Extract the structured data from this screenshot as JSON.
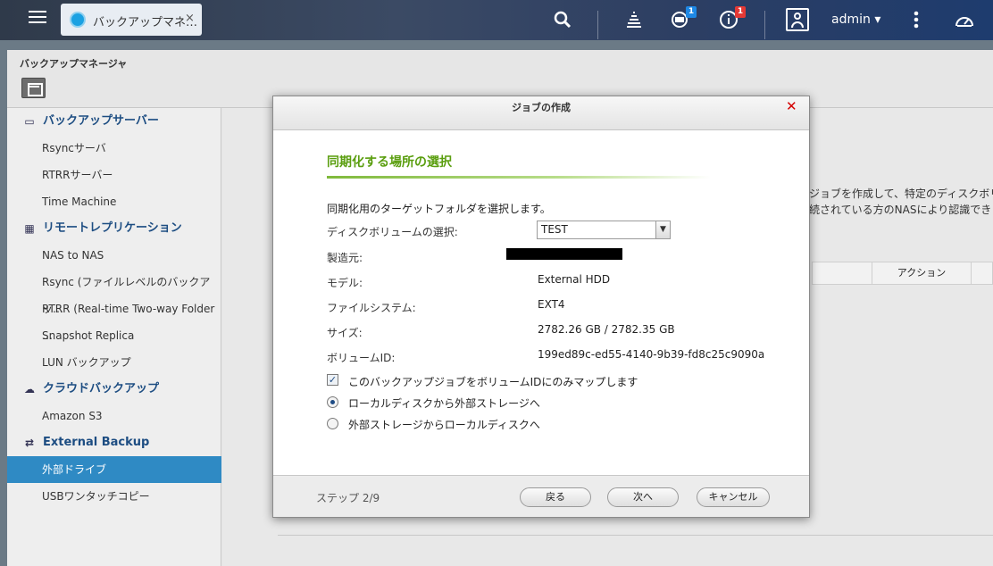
{
  "topbar": {
    "app_tab_title": "バックアップマネ…",
    "app_tab_close": "×",
    "user_name": "admin ▾",
    "badge_backup_count": "1",
    "badge_notice_count": "1"
  },
  "window": {
    "title": "バックアップマネージャ"
  },
  "sidebar": {
    "groups": [
      {
        "label": "バックアップサーバー",
        "items": [
          "Rsyncサーバ",
          "RTRRサーバー",
          "Time Machine"
        ]
      },
      {
        "label": "リモートレプリケーション",
        "items": [
          "NAS to NAS",
          "Rsync (ファイルレベルのバックアッ…",
          "RTRR (Real-time Two-way Folder …",
          "Snapshot Replica",
          "LUN バックアップ"
        ]
      },
      {
        "label": "クラウドバックアップ",
        "items": [
          "Amazon S3"
        ]
      },
      {
        "label": "External Backup",
        "items": [
          "外部ドライブ",
          "USBワンタッチコピー"
        ]
      }
    ],
    "active_item": "外部ドライブ"
  },
  "content": {
    "text_line1": "ジョブを作成して、特定のディスクボリュー",
    "text_line2": "続されている方のNASにより認識できます",
    "table_action_header": "アクション"
  },
  "dialog": {
    "title": "ジョブの作成",
    "close": "✕",
    "heading": "同期化する場所の選択",
    "intro": "同期化用のターゲットフォルダを選択します。",
    "disk_volume_label": "ディスクボリュームの選択:",
    "disk_volume_value": "TEST",
    "manufacturer_label": "製造元:",
    "model_label": "モデル:",
    "model_value": "External HDD",
    "filesystem_label": "ファイルシステム:",
    "filesystem_value": "EXT4",
    "size_label": "サイズ:",
    "size_value": "2782.26 GB / 2782.35 GB",
    "volume_id_label": "ボリュームID:",
    "volume_id_value": "199ed89c-ed55-4140-9b39-fd8c25c9090a",
    "map_by_volume_id_label": "このバックアップジョブをボリュームIDにのみマップします",
    "map_by_volume_id_checked": true,
    "direction_options": [
      "ローカルディスクから外部ストレージへ",
      "外部ストレージからローカルディスクへ"
    ],
    "direction_selected": 0,
    "step": "ステップ 2/9",
    "back_button": "戻る",
    "next_button": "次へ",
    "cancel_button": "キャンセル"
  },
  "colors": {
    "accent_active": "#2f8ac4",
    "heading_green": "#5a9e0f",
    "close_red": "#d40000"
  }
}
